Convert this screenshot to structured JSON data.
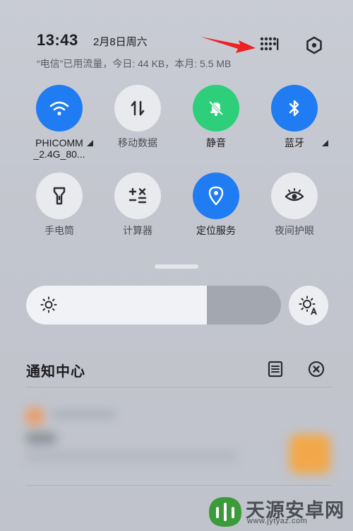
{
  "status": {
    "time": "13:43",
    "date": "2月8日周六",
    "usage": "“电信”已用流量，今日: 44 KB，本月: 5.5 MB"
  },
  "header_icons": {
    "grid": "grid-edit-icon",
    "settings": "settings-icon"
  },
  "tiles_row1": [
    {
      "label": "PHICOMM",
      "sublabel": "_2.4G_80...",
      "icon": "wifi-icon",
      "state": "on",
      "color": "#1f7cf2"
    },
    {
      "label": "移动数据",
      "icon": "mobile-data-icon",
      "state": "off"
    },
    {
      "label": "静音",
      "icon": "bell-mute-icon",
      "state": "on",
      "color": "#2ecf7a"
    },
    {
      "label": "蓝牙",
      "icon": "bluetooth-icon",
      "state": "on",
      "color": "#1f7cf2"
    }
  ],
  "tiles_row2": [
    {
      "label": "手电筒",
      "icon": "flashlight-icon",
      "state": "off"
    },
    {
      "label": "计算器",
      "icon": "calculator-icon",
      "state": "off"
    },
    {
      "label": "定位服务",
      "icon": "location-icon",
      "state": "on",
      "color": "#1f7cf2"
    },
    {
      "label": "夜间护眼",
      "icon": "eye-icon",
      "state": "off"
    }
  ],
  "brightness": {
    "level": 0.71,
    "icon": "sun-icon",
    "auto_icon": "auto-brightness-icon"
  },
  "notification_center": {
    "title": "通知中心",
    "manage_icon": "notification-manage-icon",
    "clear_icon": "clear-all-icon"
  },
  "watermark": {
    "text": "天源安卓网",
    "url": "www.jytyaz.com"
  }
}
